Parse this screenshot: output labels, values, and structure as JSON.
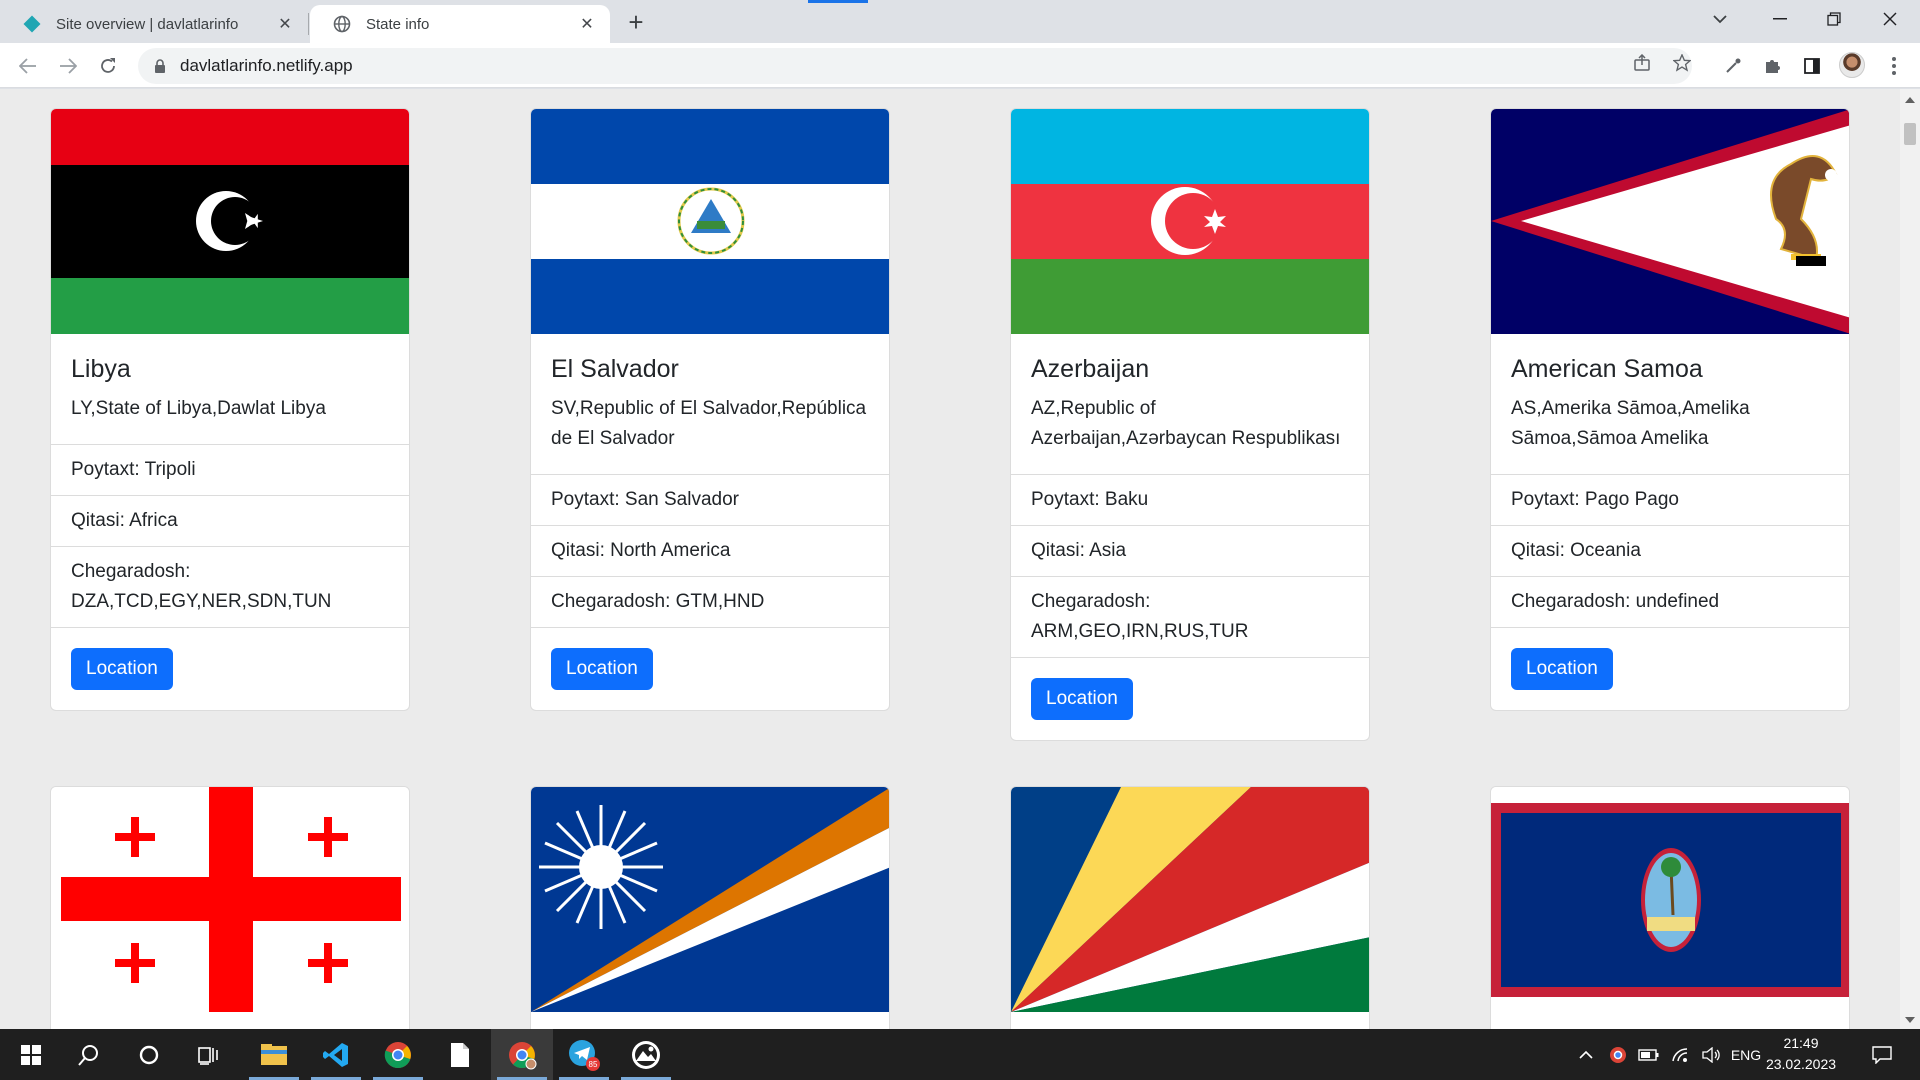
{
  "browser": {
    "tabs": [
      {
        "title": "Site overview | davlatlarinfo",
        "active": false
      },
      {
        "title": "State info",
        "active": true
      }
    ],
    "url": "davlatlarinfo.netlify.app"
  },
  "labels": {
    "capital": "Poytaxt: ",
    "continent": "Qitasi: ",
    "borders": "Chegaradosh: ",
    "location_button": "Location"
  },
  "countries": [
    {
      "name": "Libya",
      "official": "LY,State of Libya,Dawlat Libya",
      "capital": "Poytaxt: Tripoli",
      "continent": "Qitasi: Africa",
      "borders": "Chegaradosh: DZA,TCD,EGY,NER,SDN,TUN"
    },
    {
      "name": "El Salvador",
      "official": "SV,Republic of El Salvador,República de El Salvador",
      "capital": "Poytaxt: San Salvador",
      "continent": "Qitasi: North America",
      "borders": "Chegaradosh: GTM,HND"
    },
    {
      "name": "Azerbaijan",
      "official": "AZ,Republic of Azerbaijan,Azərbaycan Respublikası",
      "capital": "Poytaxt: Baku",
      "continent": "Qitasi: Asia",
      "borders": "Chegaradosh: ARM,GEO,IRN,RUS,TUR"
    },
    {
      "name": "American Samoa",
      "official": "AS,Amerika Sāmoa,Amelika Sāmoa,Sāmoa Amelika",
      "capital": "Poytaxt: Pago Pago",
      "continent": "Qitasi: Oceania",
      "borders": "Chegaradosh: undefined"
    }
  ],
  "second_row_flags": [
    "georgia-flag",
    "marshall-islands-flag",
    "seychelles-flag",
    "guam-flag"
  ],
  "taskbar": {
    "language": "ENG",
    "time": "21:49",
    "date": "23.02.2023",
    "telegram_badge": "85"
  },
  "colors": {
    "primary": "#0d6efd",
    "page_bg": "#ebebeb",
    "taskbar_bg": "#1f1f1f"
  }
}
